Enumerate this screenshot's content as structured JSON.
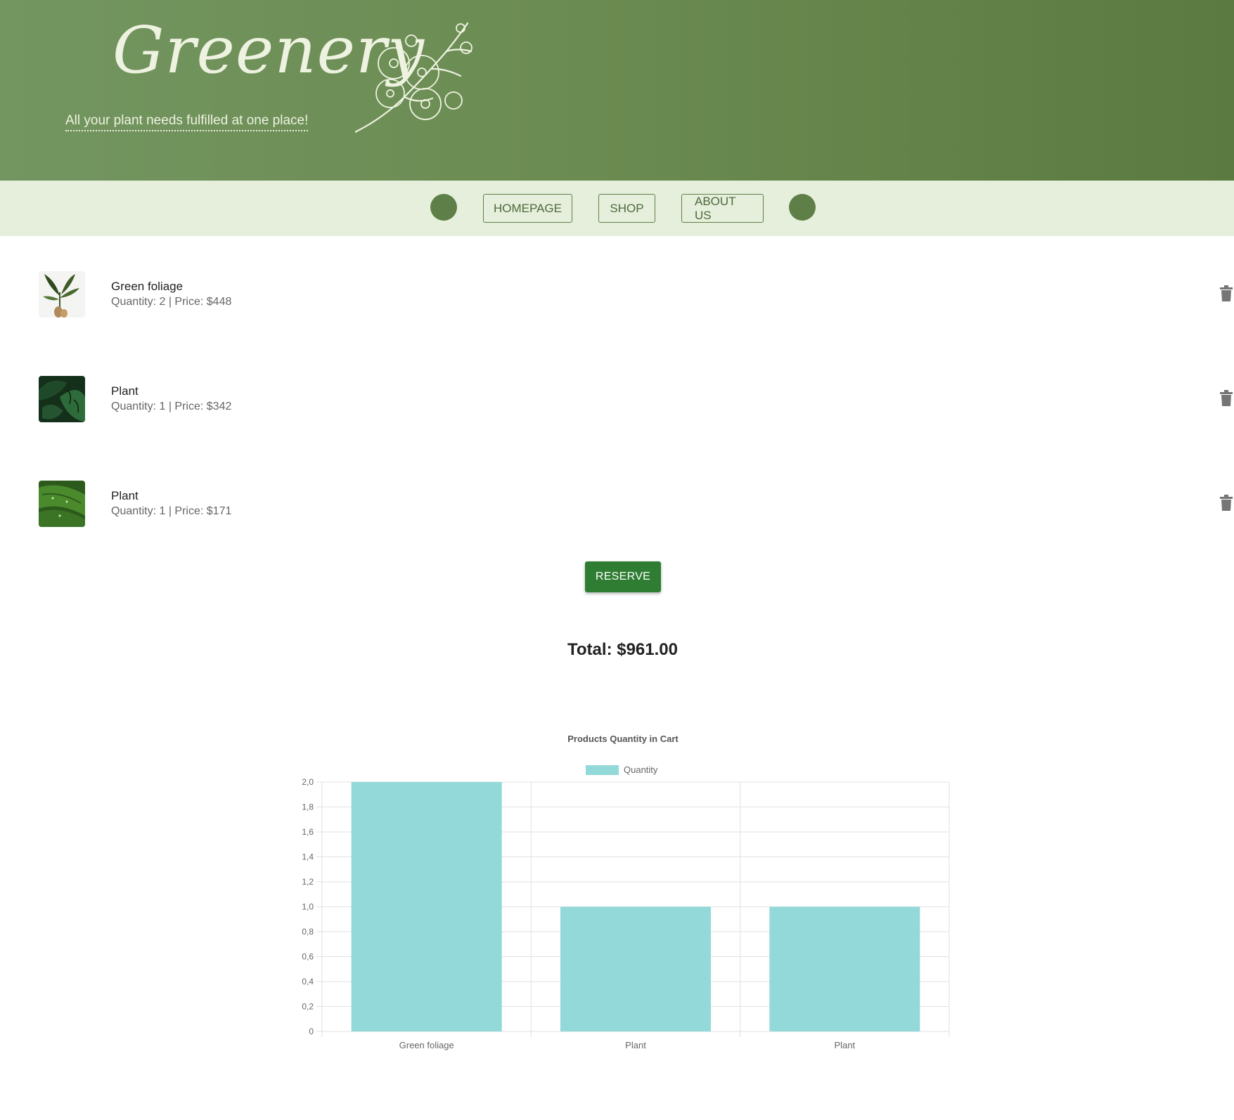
{
  "header": {
    "logo": "Greenery",
    "tagline": "All your plant needs fulfilled at one place!"
  },
  "nav": {
    "items": [
      "HOMEPAGE",
      "SHOP",
      "ABOUT US"
    ]
  },
  "cart": {
    "items": [
      {
        "name": "Green foliage",
        "meta": "Quantity: 2 | Price: $448"
      },
      {
        "name": "Plant",
        "meta": "Quantity: 1 | Price: $342"
      },
      {
        "name": "Plant",
        "meta": "Quantity: 1 | Price: $171"
      }
    ],
    "reserve_label": "RESERVE",
    "total": "Total: $961.00"
  },
  "colors": {
    "header": "#6b8c52",
    "nav_bg": "#e6efdc",
    "accent": "#5e7f47",
    "reserve": "#2e7d32",
    "bar_fill": "#94d9d9"
  },
  "chart_data": {
    "type": "bar",
    "title": "Products Quantity in Cart",
    "categories": [
      "Green foliage",
      "Plant",
      "Plant"
    ],
    "series": [
      {
        "name": "Quantity",
        "values": [
          2,
          1,
          1
        ]
      }
    ],
    "ylim": [
      0,
      2
    ],
    "yticks": [
      "0",
      "0,2",
      "0,4",
      "0,6",
      "0,8",
      "1,0",
      "1,2",
      "1,4",
      "1,6",
      "1,8",
      "2,0"
    ],
    "grid": true,
    "legend": "top"
  }
}
